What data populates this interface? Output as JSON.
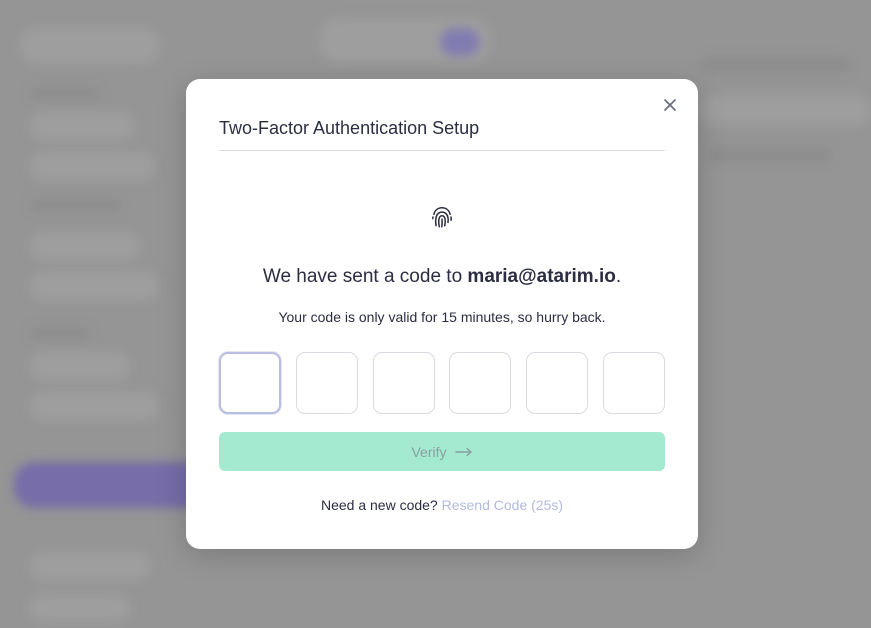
{
  "modal": {
    "title": "Two-Factor Authentication Setup",
    "headline_prefix": "We have sent a code to ",
    "email": "maria@atarim.io",
    "headline_suffix": ".",
    "subtext": "Your code is only valid for 15 minutes, so hurry back.",
    "code_values": [
      "",
      "",
      "",
      "",
      "",
      ""
    ],
    "verify_label": "Verify",
    "resend_prompt": "Need a new code?",
    "resend_label": "Resend Code (25s)"
  },
  "icons": {
    "close": "close-icon",
    "fingerprint": "fingerprint-icon",
    "arrow": "arrow-right-icon"
  },
  "colors": {
    "verify_bg": "#a3ead0",
    "resend_link": "#b3bbde",
    "title_text": "#2b2d42"
  }
}
